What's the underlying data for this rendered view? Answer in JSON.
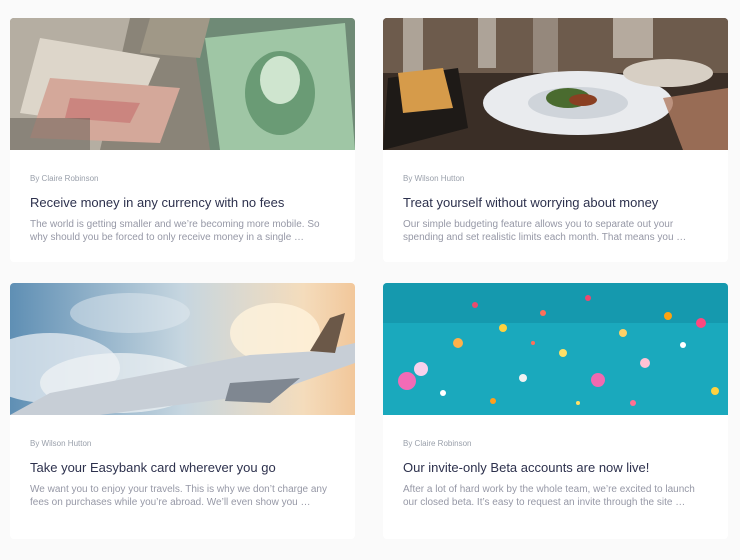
{
  "articles": [
    {
      "author": "By Claire Robinson",
      "title": "Receive money in any currency with no fees",
      "excerpt": "The world is getting smaller and we’re becoming more mobile. So why should you be forced to only receive money in a single …",
      "image_icon": "currency-image"
    },
    {
      "author": "By Wilson Hutton",
      "title": "Treat yourself without worrying about money",
      "excerpt": "Our simple budgeting feature allows you to separate out your spending and set realistic limits each month. That means you …",
      "image_icon": "restaurant-image"
    },
    {
      "author": "By Wilson Hutton",
      "title": "Take your Easybank card wherever you go",
      "excerpt": "We want you to enjoy your travels. This is why we don’t charge any fees on purchases while you’re abroad. We’ll even show you …",
      "image_icon": "plane-image"
    },
    {
      "author": "By Claire Robinson",
      "title": "Our invite-only Beta accounts are now live!",
      "excerpt": "After a lot of hard work by the whole team, we’re excited to launch our closed beta. It’s easy to request an invite through the site …",
      "image_icon": "confetti-image"
    }
  ]
}
